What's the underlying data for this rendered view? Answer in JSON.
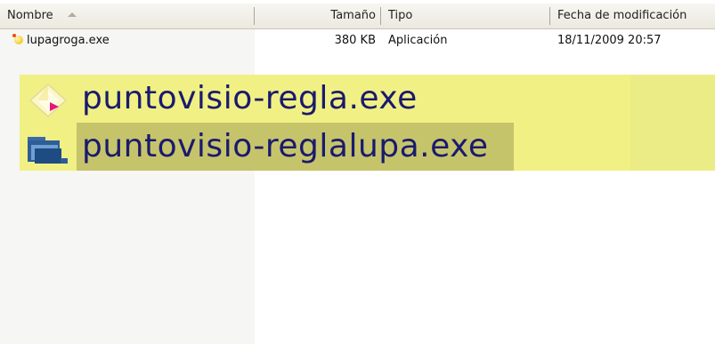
{
  "header": {
    "name_label": "Nombre",
    "size_label": "Tamaño",
    "type_label": "Tipo",
    "date_label": "Fecha de modificación"
  },
  "files": [
    {
      "name": "lupagroga.exe",
      "size": "380 KB",
      "type": "Aplicación",
      "date": "18/11/2009 20:57",
      "icon": "lupa-app-icon"
    }
  ],
  "zoomed_files": [
    {
      "name": "puntovisio-regla.exe",
      "icon": "diamond-app-icon"
    },
    {
      "name": "puntovisio-reglalupa.exe",
      "icon": "folder-app-icon"
    }
  ],
  "colors": {
    "zoom_highlight": "#f1f084",
    "zoom_selected": "#c6c46a",
    "zoom_text": "#1a1a6e"
  }
}
